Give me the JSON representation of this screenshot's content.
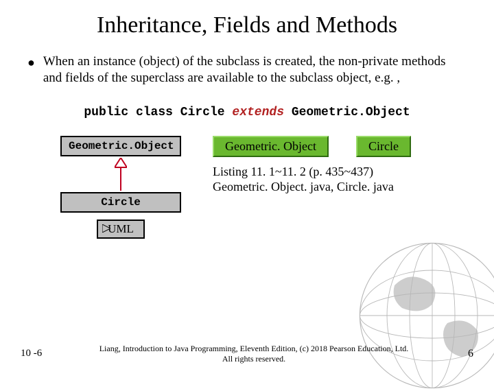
{
  "title": "Inheritance, Fields and Methods",
  "body": "When an instance (object) of the subclass is created, the non-private methods and fields of the superclass are available to the subclass object, e.g. ,",
  "code": {
    "pre": "public class Circle ",
    "kw": "extends",
    "post": " Geometric.Object"
  },
  "uml": {
    "super": "Geometric.Object",
    "sub": "Circle",
    "label": "UML"
  },
  "buttons": {
    "geom": "Geometric. Object",
    "circle": "Circle"
  },
  "listing": {
    "line1": "Listing 11. 1~11. 2 (p. 435~437)",
    "line2": "Geometric. Object. java, Circle. java"
  },
  "footer": {
    "slide_no": "10 -6",
    "copyright1": "Liang, Introduction to Java Programming, Eleventh Edition, (c) 2018 Pearson Education, Ltd.",
    "copyright2": "All rights reserved.",
    "page_no": "6"
  }
}
